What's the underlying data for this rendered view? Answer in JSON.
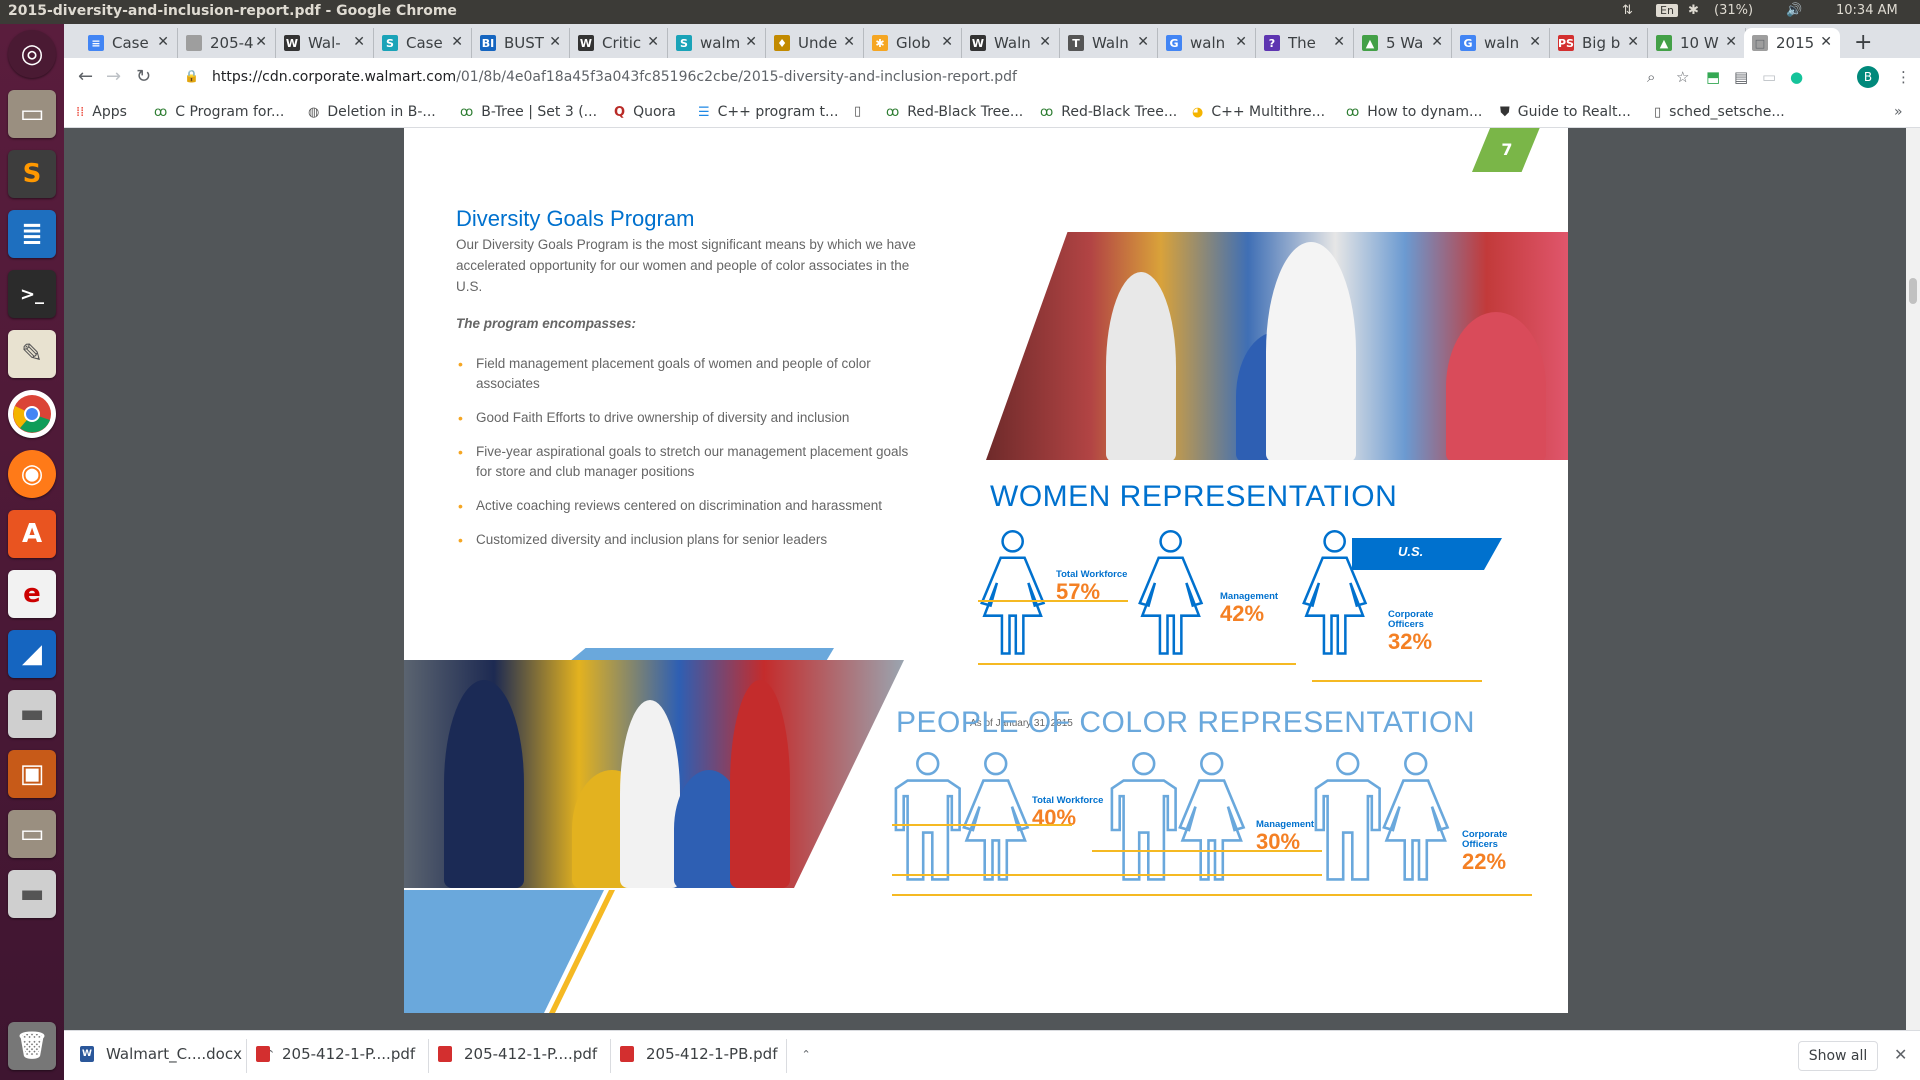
{
  "window": {
    "title": "2015-diversity-and-inclusion-report.pdf - Google Chrome"
  },
  "tray": {
    "network": "⇅",
    "lang": "En",
    "bluetooth": "✱",
    "battery": "(31%)",
    "volume": "🔊",
    "clock": "10:34 AM"
  },
  "tabs": [
    {
      "label": "Case",
      "icon_color": "#4285f4",
      "icon_char": "≡"
    },
    {
      "label": "205-4",
      "icon_color": "#9e9e9e",
      "icon_char": ""
    },
    {
      "label": "Wal-",
      "icon_color": "#333333",
      "icon_char": "W"
    },
    {
      "label": "Case",
      "icon_color": "#1aa3b8",
      "icon_char": "S"
    },
    {
      "label": "BUST",
      "icon_color": "#1565c0",
      "icon_char": "BI"
    },
    {
      "label": "Critic",
      "icon_color": "#333333",
      "icon_char": "W"
    },
    {
      "label": "walm",
      "icon_color": "#1aa3b8",
      "icon_char": "S"
    },
    {
      "label": "Unde",
      "icon_color": "#c28a00",
      "icon_char": "♦"
    },
    {
      "label": "Glob",
      "icon_color": "#f5a623",
      "icon_char": "✱"
    },
    {
      "label": "Waln",
      "icon_color": "#333333",
      "icon_char": "W"
    },
    {
      "label": "Waln",
      "icon_color": "#555555",
      "icon_char": "T"
    },
    {
      "label": "waln",
      "icon_color": "#4285f4",
      "icon_char": "G"
    },
    {
      "label": "The",
      "icon_color": "#5e35b1",
      "icon_char": "?"
    },
    {
      "label": "5 Wa",
      "icon_color": "#43a047",
      "icon_char": "▲"
    },
    {
      "label": "waln",
      "icon_color": "#4285f4",
      "icon_char": "G"
    },
    {
      "label": "Big b",
      "icon_color": "#d32f2f",
      "icon_char": "PS"
    },
    {
      "label": "10 W",
      "icon_color": "#43a047",
      "icon_char": "▲"
    },
    {
      "label": "2015",
      "icon_color": "#9e9e9e",
      "icon_char": "□"
    }
  ],
  "toolbar": {
    "url_host": "https://cdn.corporate.walmart.com",
    "url_path": "/01/8b/4e0af18a45f3a043fc85196c2cbe/2015-diversity-and-inclusion-report.pdf",
    "avatar_letter": "B"
  },
  "bookmarks": [
    {
      "label": "Apps"
    },
    {
      "label": "C Program for..."
    },
    {
      "label": "Deletion in B-..."
    },
    {
      "label": "B-Tree | Set 3 (..."
    },
    {
      "label": "Quora"
    },
    {
      "label": "C++ program t..."
    },
    {
      "label": ""
    },
    {
      "label": "Red-Black Tree..."
    },
    {
      "label": "Red-Black Tree..."
    },
    {
      "label": "C++ Multithre..."
    },
    {
      "label": "How to dynam..."
    },
    {
      "label": "Guide to Realt..."
    },
    {
      "label": "sched_setsche..."
    }
  ],
  "pdf": {
    "page_number": "7",
    "heading": "Diversity Goals Program",
    "intro": "Our Diversity Goals Program is the most significant means by which we have accelerated opportunity for our women and people of color associates in the U.S.",
    "program_label": "The program encompasses:",
    "bullets": [
      "Field management placement goals of women and people of color associates",
      "Good Faith Efforts to drive ownership of diversity and inclusion",
      "Five-year aspirational goals to stretch our management placement goals for store and club manager positions",
      "Active coaching reviews centered on discrimination and harassment",
      "Customized diversity and inclusion plans for senior leaders"
    ],
    "women": {
      "title": "WOMEN REPRESENTATION",
      "region": "U.S.",
      "as_of": "As of January 31, 2015",
      "stats": [
        {
          "label_1": "Total Workforce",
          "label_2": "",
          "value": "57%",
          "fraction": 0.57
        },
        {
          "label_1": "Management",
          "label_2": "",
          "value": "42%",
          "fraction": 0.42
        },
        {
          "label_1": "Corporate",
          "label_2": "Officers",
          "value": "32%",
          "fraction": 0.32
        }
      ]
    },
    "people_of_color": {
      "title": "PEOPLE OF COLOR REPRESENTATION",
      "stats": [
        {
          "label_1": "Total Workforce",
          "label_2": "",
          "value": "40%",
          "fraction": 0.4
        },
        {
          "label_1": "Management",
          "label_2": "",
          "value": "30%",
          "fraction": 0.3
        },
        {
          "label_1": "Corporate",
          "label_2": "Officers",
          "value": "22%",
          "fraction": 0.22
        }
      ]
    },
    "colors": {
      "blue": "#0071ce",
      "light_blue": "#6aa8dc",
      "orange": "#f48024",
      "yellow": "#f5b923",
      "green": "#7ab648"
    }
  },
  "downloads": {
    "items": [
      {
        "label": "Walmart_C....docx",
        "icon_color": "#2b579a",
        "icon_char": "W"
      },
      {
        "label": "205-412-1-P....pdf",
        "icon_color": "#d32f2f",
        "icon_char": ""
      },
      {
        "label": "205-412-1-P....pdf",
        "icon_color": "#d32f2f",
        "icon_char": ""
      },
      {
        "label": "205-412-1-PB.pdf",
        "icon_color": "#d32f2f",
        "icon_char": ""
      }
    ],
    "show_all": "Show all"
  }
}
